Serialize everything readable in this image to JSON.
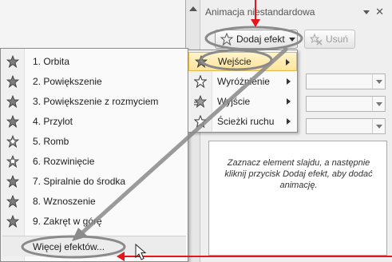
{
  "task_pane": {
    "title": "Animacja niestandardowa",
    "close_glyph": "✕",
    "add_effect_label": "Dodaj efekt",
    "remove_label": "Usuń",
    "info_text": "Zaznacz element slajdu, a następnie kliknij przycisk Dodaj efekt, aby dodać animację."
  },
  "effects_menu": {
    "items": [
      {
        "label": "1. Orbita",
        "icon": "star-orbit-icon"
      },
      {
        "label": "2. Powiększenie",
        "icon": "star-zoom-icon"
      },
      {
        "label": "3. Powiększenie z rozmyciem",
        "icon": "star-blur-icon"
      },
      {
        "label": "4. Przylot",
        "icon": "star-fly-icon"
      },
      {
        "label": "5. Romb",
        "icon": "star-diamond-icon"
      },
      {
        "label": "6. Rozwinięcie",
        "icon": "star-expand-icon"
      },
      {
        "label": "7. Spiralnie do środka",
        "icon": "star-spiral-icon"
      },
      {
        "label": "8. Wznoszenie",
        "icon": "star-rise-icon"
      },
      {
        "label": "9. Zakręt w górę",
        "icon": "star-turn-icon"
      }
    ],
    "more_label": "Więcej efektów..."
  },
  "submenu": {
    "items": [
      {
        "label": "Wejście",
        "icon": "entrance-star-icon"
      },
      {
        "label": "Wyróżnienie",
        "icon": "emphasis-star-icon"
      },
      {
        "label": "Wyjście",
        "icon": "exit-star-icon"
      },
      {
        "label": "Ścieżki ruchu",
        "icon": "motion-path-star-icon"
      }
    ]
  },
  "colors": {
    "annotation_red": "#e8141c",
    "highlight_ring": "#8a8a8a"
  }
}
